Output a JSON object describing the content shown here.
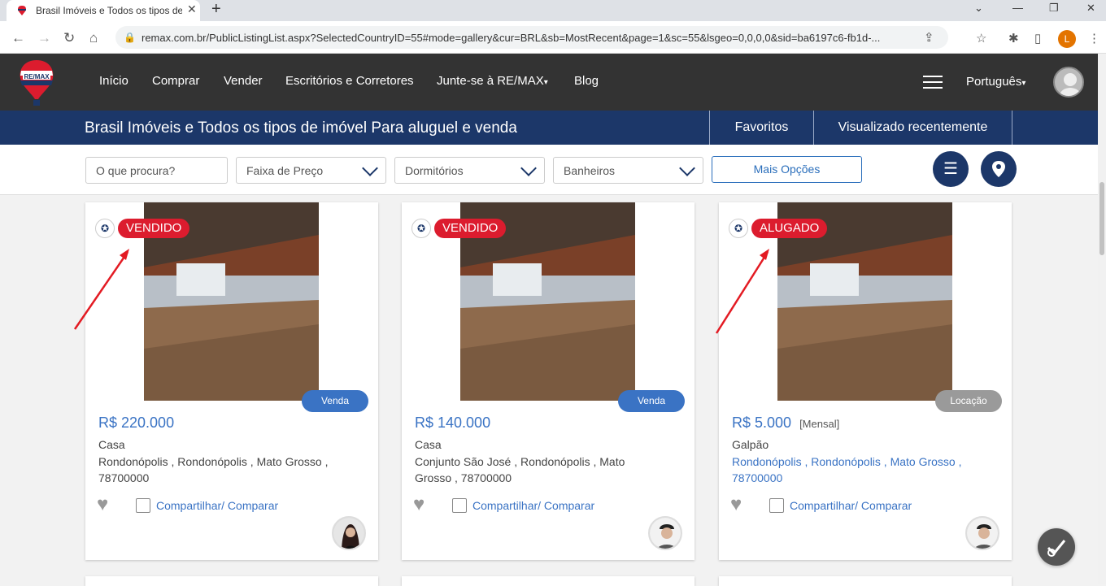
{
  "browser": {
    "tab_title": "Brasil Imóveis e Todos os tipos de imóvel",
    "url": "remax.com.br/PublicListingList.aspx?SelectedCountryID=55#mode=gallery&cur=BRL&sb=MostRecent&page=1&sc=55&lsgeo=0,0,0,0&sid=ba6197c6-fb1d-...",
    "profile_initial": "L"
  },
  "nav": {
    "items": [
      "Início",
      "Comprar",
      "Vender",
      "Escritórios e Corretores",
      "Junte-se à RE/MAX",
      "Blog"
    ],
    "language": "Português"
  },
  "banner": {
    "title": "Brasil Imóveis e Todos os tipos de imóvel Para aluguel e venda",
    "favorites": "Favoritos",
    "recent": "Visualizado recentemente"
  },
  "filters": {
    "search_placeholder": "O que procura?",
    "price": "Faixa de Preço",
    "bedrooms": "Dormitórios",
    "bathrooms": "Banheiros",
    "more": "Mais Opções"
  },
  "listings": [
    {
      "status": "VENDIDO",
      "tag": "Venda",
      "tag_color": "#3a73c4",
      "price": "R$ 220.000",
      "period": "",
      "type": "Casa",
      "location": "Rondonópolis , Rondonópolis , Mato Grosso , 78700000",
      "share": "Compartilhar/ Comparar"
    },
    {
      "status": "VENDIDO",
      "tag": "Venda",
      "tag_color": "#3a73c4",
      "price": "R$ 140.000",
      "period": "",
      "type": "Casa",
      "location": "Conjunto São José , Rondonópolis , Mato Grosso , 78700000",
      "share": "Compartilhar/ Comparar"
    },
    {
      "status": "ALUGADO",
      "tag": "Locação",
      "tag_color": "#9a9a9a",
      "price": "R$ 5.000",
      "period": "[Mensal]",
      "type": "Galpão",
      "location": "Rondonópolis , Rondonópolis , Mato Grosso , 78700000",
      "share": "Compartilhar/ Comparar"
    }
  ],
  "colors": {
    "header": "#333333",
    "banner": "#1c3769",
    "status": "#dc1c2e",
    "link": "#3a73c4"
  }
}
